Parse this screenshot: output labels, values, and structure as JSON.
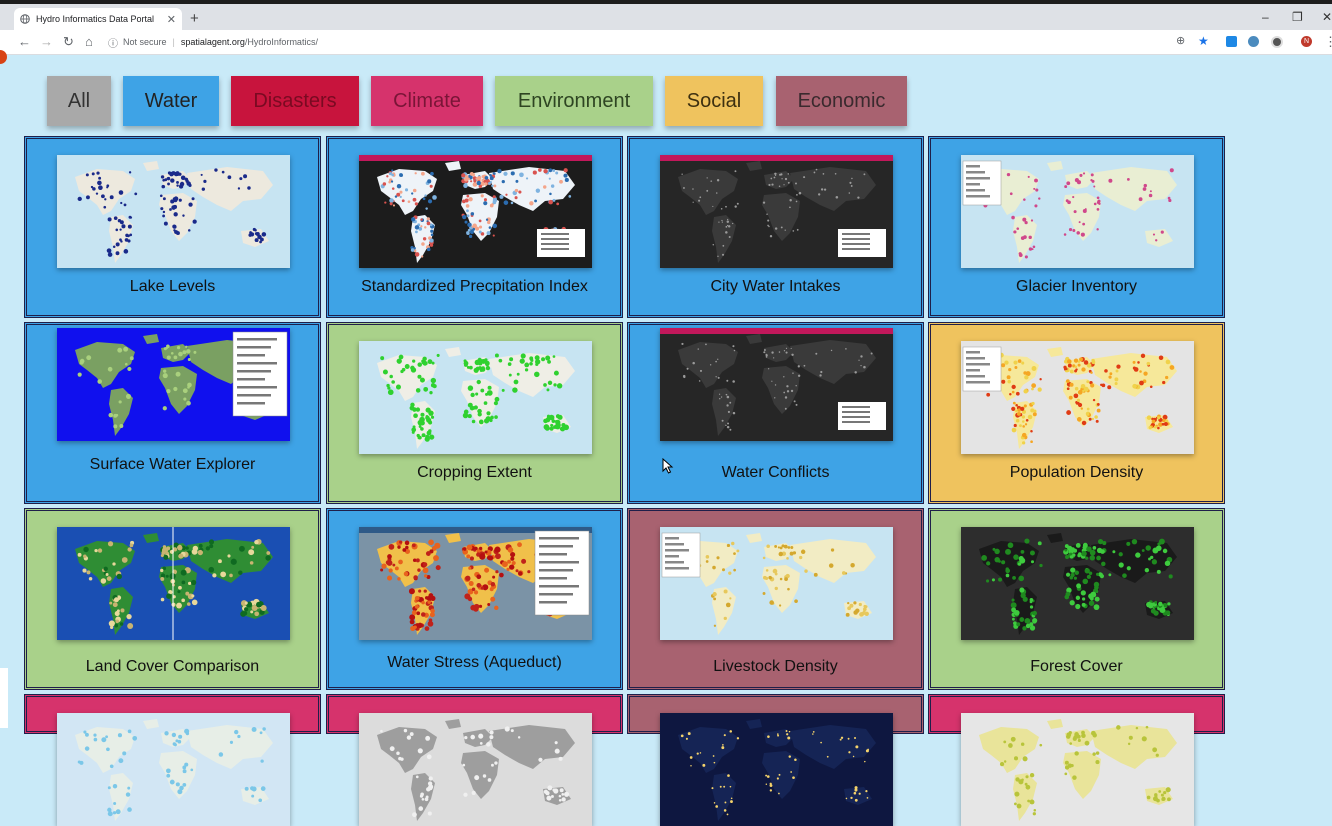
{
  "browser": {
    "tab_title": "Hydro Informatics Data Portal",
    "tab_close": "✕",
    "new_tab": "+",
    "security_label": "Not secure",
    "url_host": "spatialagent.org",
    "url_path": "/HydroInformatics/",
    "profile_initial": "N"
  },
  "filters": [
    {
      "label": "All",
      "color": "#a9a9a9"
    },
    {
      "label": "Water",
      "color": "#3ea3e6"
    },
    {
      "label": "Disasters",
      "color": "#c8143d"
    },
    {
      "label": "Climate",
      "color": "#d6336c"
    },
    {
      "label": "Environment",
      "color": "#a9d18a"
    },
    {
      "label": "Social",
      "color": "#efc35e"
    },
    {
      "label": "Economic",
      "color": "#a86270"
    }
  ],
  "cards": [
    {
      "label": "Lake Levels",
      "category": "Water",
      "color": "#3ea3e6",
      "thumb_style": "lakes"
    },
    {
      "label": "Standardized Precpitation Index",
      "category": "Water",
      "color": "#3ea3e6",
      "thumb_style": "spi"
    },
    {
      "label": "City Water Intakes",
      "category": "Water",
      "color": "#3ea3e6",
      "thumb_style": "darkmap"
    },
    {
      "label": "Glacier Inventory",
      "category": "Water",
      "color": "#3ea3e6",
      "thumb_style": "glacier"
    },
    {
      "label": "Surface Water Explorer",
      "category": "Water",
      "color": "#3ea3e6",
      "thumb_style": "surfacewater"
    },
    {
      "label": "Cropping Extent",
      "category": "Environment",
      "color": "#a9d18a",
      "thumb_style": "crop"
    },
    {
      "label": "Water Conflicts",
      "category": "Water",
      "color": "#3ea3e6",
      "thumb_style": "darkmap"
    },
    {
      "label": "Population Density",
      "category": "Social",
      "color": "#efc35e",
      "thumb_style": "population"
    },
    {
      "label": "Land Cover Comparison",
      "category": "Environment",
      "color": "#a9d18a",
      "thumb_style": "landcover"
    },
    {
      "label": "Water Stress (Aqueduct)",
      "category": "Water",
      "color": "#3ea3e6",
      "thumb_style": "waterstress"
    },
    {
      "label": "Livestock Density",
      "category": "Economic",
      "color": "#a86270",
      "thumb_style": "livestock"
    },
    {
      "label": "Forest Cover",
      "category": "Environment",
      "color": "#a9d18a",
      "thumb_style": "forest"
    },
    {
      "label": "",
      "category": "Climate",
      "color": "#d6336c",
      "thumb_style": "lightmap"
    },
    {
      "label": "",
      "category": "Climate",
      "color": "#d6336c",
      "thumb_style": "greymap"
    },
    {
      "label": "",
      "category": "Economic",
      "color": "#a86270",
      "thumb_style": "night"
    },
    {
      "label": "",
      "category": "Climate",
      "color": "#d6336c",
      "thumb_style": "yellowmap"
    }
  ]
}
